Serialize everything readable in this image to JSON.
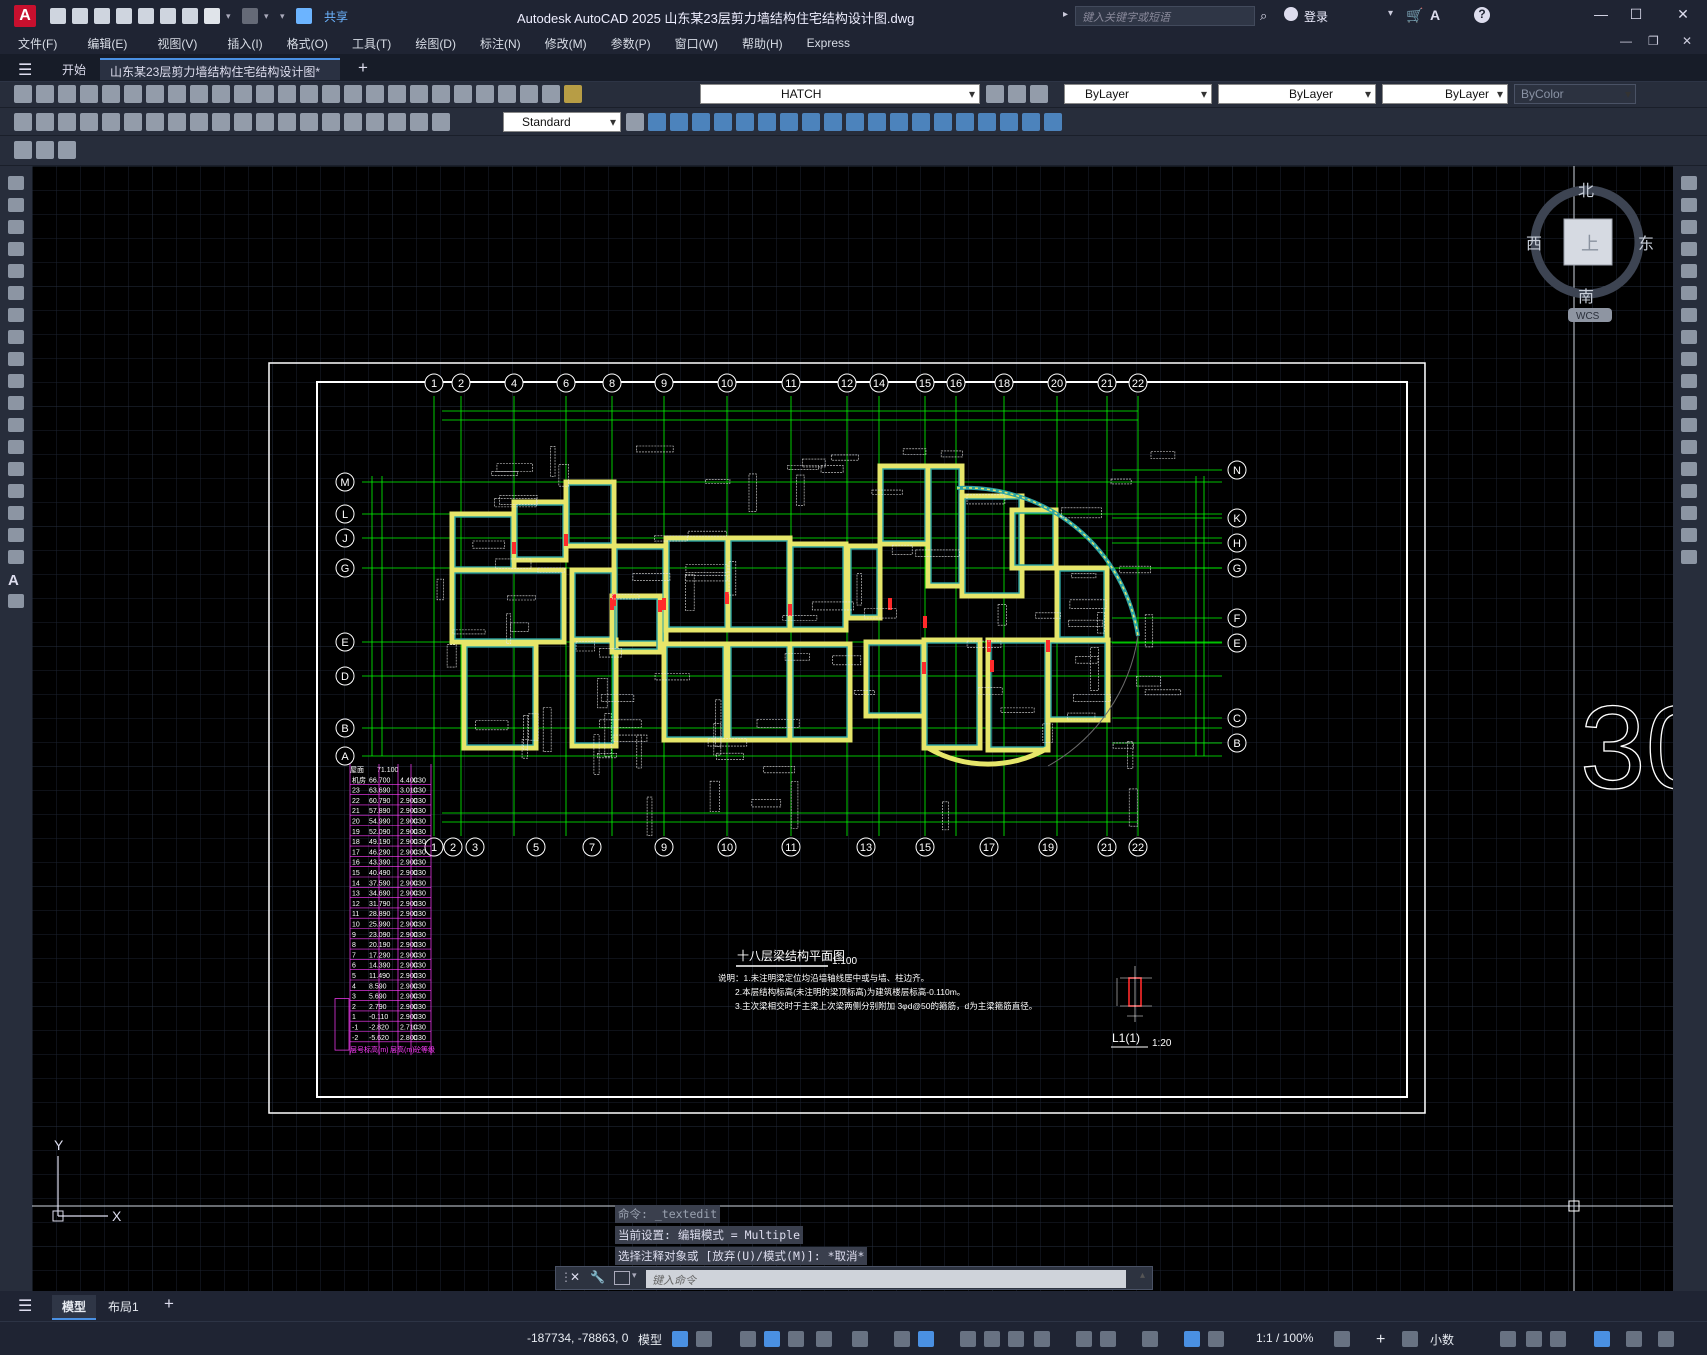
{
  "app": {
    "title": "Autodesk AutoCAD 2025    山东某23层剪力墙结构住宅结构设计图.dwg",
    "share_label": "共享",
    "search_placeholder": "键入关键字或短语",
    "login_label": "登录"
  },
  "menu": [
    "文件(F)",
    "编辑(E)",
    "视图(V)",
    "插入(I)",
    "格式(O)",
    "工具(T)",
    "绘图(D)",
    "标注(N)",
    "修改(M)",
    "参数(P)",
    "窗口(W)",
    "帮助(H)",
    "Express"
  ],
  "tabs": {
    "start": "开始",
    "document": "山东某23层剪力墙结构住宅结构设计图*"
  },
  "properties": {
    "layer": "HATCH",
    "color": "ByLayer",
    "linetype": "ByLayer",
    "lineweight": "ByLayer",
    "plotstyle": "ByColor",
    "textstyle": "Standard"
  },
  "viewcube": {
    "north": "北",
    "south": "南",
    "west": "西",
    "east": "东",
    "top": "上",
    "wcs": "WCS"
  },
  "drawing": {
    "title": "十八层梁结构平面图",
    "scale": "1:100",
    "notes": [
      "说明：1.未注明梁定位均沿墙轴线居中或与墙、柱边齐。",
      "2.本层结构标高(未注明的梁顶标高)为建筑楼层标高-0.110m。",
      "3.主次梁相交时于主梁上次梁两侧分别附加 3φd@50的箍筋，d为主梁箍筋直径。"
    ],
    "detail_label": "L1(1)",
    "detail_scale": "1:20",
    "big_text": "30",
    "grid_top": [
      "1",
      "2",
      "4",
      "6",
      "8",
      "9",
      "10",
      "11",
      "12",
      "14",
      "15",
      "16",
      "18",
      "20",
      "21",
      "22"
    ],
    "grid_bottom": [
      "1",
      "2",
      "3",
      "5",
      "7",
      "9",
      "10",
      "11",
      "13",
      "15",
      "17",
      "19",
      "21",
      "22"
    ],
    "grid_left": [
      "M",
      "L",
      "J",
      "G",
      "E",
      "D",
      "B",
      "A"
    ],
    "grid_right": [
      "N",
      "K",
      "H",
      "G",
      "F",
      "E",
      "C",
      "B"
    ],
    "level_table_header": [
      "屋面",
      "71.100"
    ],
    "level_rows": [
      [
        "机房",
        "66.700",
        "4.400",
        "C30"
      ],
      [
        "23",
        "63.690",
        "3.010",
        "C30"
      ],
      [
        "22",
        "60.790",
        "2.900",
        "C30"
      ],
      [
        "21",
        "57.890",
        "2.900",
        "C30"
      ],
      [
        "20",
        "54.990",
        "2.900",
        "C30"
      ],
      [
        "19",
        "52.090",
        "2.900",
        "C30"
      ],
      [
        "18",
        "49.190",
        "2.900",
        "C30"
      ],
      [
        "17",
        "46.290",
        "2.900",
        "C30"
      ],
      [
        "16",
        "43.390",
        "2.900",
        "C30"
      ],
      [
        "15",
        "40.490",
        "2.900",
        "C30"
      ],
      [
        "14",
        "37.590",
        "2.900",
        "C30"
      ],
      [
        "13",
        "34.690",
        "2.900",
        "C30"
      ],
      [
        "12",
        "31.790",
        "2.900",
        "C30"
      ],
      [
        "11",
        "28.890",
        "2.900",
        "C30"
      ],
      [
        "10",
        "25.990",
        "2.900",
        "C30"
      ],
      [
        "9",
        "23.090",
        "2.900",
        "C30"
      ],
      [
        "8",
        "20.190",
        "2.900",
        "C30"
      ],
      [
        "7",
        "17.290",
        "2.900",
        "C30"
      ],
      [
        "6",
        "14.390",
        "2.900",
        "C30"
      ],
      [
        "5",
        "11.490",
        "2.900",
        "C30"
      ],
      [
        "4",
        "8.590",
        "2.900",
        "C30"
      ],
      [
        "3",
        "5.690",
        "2.900",
        "C30"
      ],
      [
        "2",
        "2.790",
        "2.900",
        "C30"
      ],
      [
        "1",
        "-0.110",
        "2.900",
        "C30"
      ],
      [
        "-1",
        "-2.820",
        "2.710",
        "C30"
      ],
      [
        "-2",
        "-5.620",
        "2.800",
        "C30"
      ]
    ],
    "level_footer": [
      "层号",
      "标高(m)",
      "层高(m)",
      "砼等级"
    ]
  },
  "command": {
    "history": [
      "命令: _textedit",
      "当前设置: 编辑模式 = Multiple",
      "选择注释对象或 [放弃(U)/模式(M)]: *取消*"
    ],
    "placeholder": "键入命令"
  },
  "layout_tabs": [
    "模型",
    "布局1"
  ],
  "status": {
    "coords": "-187734, -78863, 0",
    "model": "模型",
    "scale": "1:1 / 100%",
    "units": "小数"
  },
  "ucs": {
    "x": "X",
    "y": "Y"
  },
  "colors": {
    "background": "#000000",
    "grid_line": "#00ff00",
    "wall_fill": "#e6e66a",
    "wall_outline": "#2ba3a3",
    "column_red": "#ff2a2a",
    "table_magenta": "#ff3cff",
    "accent_blue": "#4a90e2"
  }
}
